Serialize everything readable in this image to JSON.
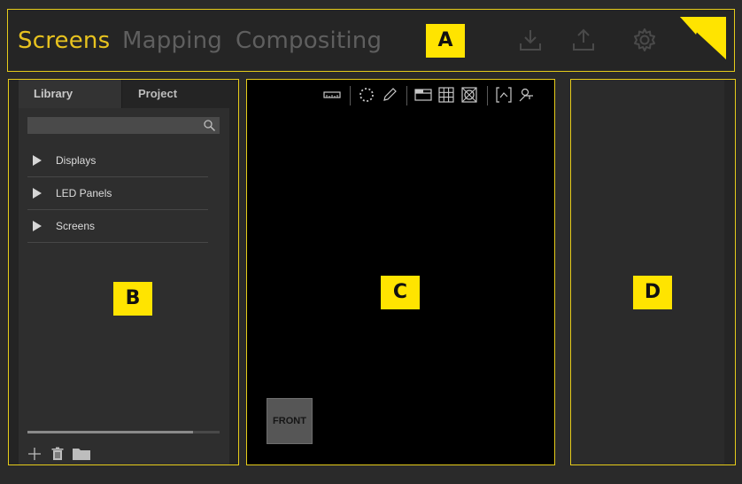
{
  "header": {
    "modes": [
      {
        "label": "Screens",
        "active": true
      },
      {
        "label": "Mapping",
        "active": false
      },
      {
        "label": "Compositing",
        "active": false
      }
    ],
    "tag": "A",
    "icons": [
      "download-icon",
      "upload-icon",
      "gear-icon",
      "logo-icon"
    ]
  },
  "library": {
    "tabs": [
      "Library",
      "Project"
    ],
    "active_tab": "Library",
    "search": {
      "value": "",
      "placeholder": ""
    },
    "items": [
      {
        "label": "Displays"
      },
      {
        "label": "LED Panels"
      },
      {
        "label": "Screens"
      }
    ],
    "tag": "B",
    "scroll_fraction": 0.86,
    "bottom_icons": [
      "add-icon",
      "trash-icon",
      "folder-icon"
    ]
  },
  "viewport": {
    "tag": "C",
    "front_label": "FRONT",
    "toolbar_icons": [
      "ruler-icon",
      "dotted-circle-icon",
      "pencil-icon",
      "window-icon",
      "grid-icon",
      "crosshair-box-icon",
      "fit-view-icon",
      "pivot-icon"
    ]
  },
  "properties": {
    "tag": "D"
  },
  "colors": {
    "accent": "#e8c31f",
    "tag_bg": "#ffe400",
    "frame": "#e6cc1a",
    "inactive_text": "#5f5f5f"
  }
}
